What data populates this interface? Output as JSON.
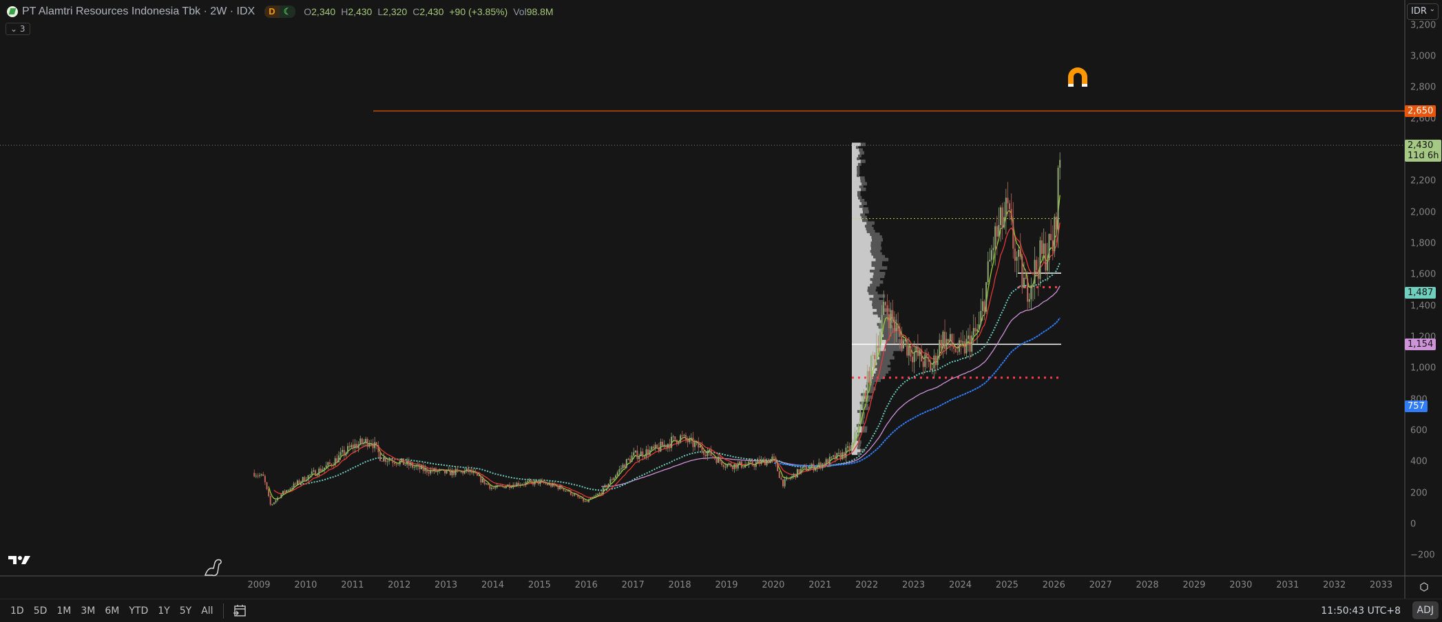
{
  "header": {
    "title": "PT Alamtri Resources Indonesia Tbk · 2W · IDX",
    "badge_d": "D",
    "badge_m": "☾",
    "open_k": "O",
    "open": "2,340",
    "high_k": "H",
    "high": "2,430",
    "low_k": "L",
    "low": "2,320",
    "close_k": "C",
    "close": "2,430",
    "change": "+90 (+3.85%)",
    "vol_k": "Vol",
    "vol": "98.8M",
    "indicators_collapsed": "⌄ 3"
  },
  "currency": {
    "label": "IDR",
    "chevron": "⌄"
  },
  "price_axis": {
    "ticks": [
      3200,
      3000,
      2800,
      2600,
      2400,
      2200,
      2000,
      1800,
      1600,
      1400,
      1200,
      1000,
      800,
      600,
      400,
      200,
      0,
      -200
    ],
    "tick_labels": [
      "3,200",
      "3,000",
      "2,800",
      "2,600",
      "",
      "2,200",
      "2,000",
      "1,800",
      "1,600",
      "1,400",
      "1,200",
      "1,000",
      "800",
      "600",
      "400",
      "200",
      "0",
      "−200"
    ],
    "labels": [
      {
        "value": 2650,
        "text": "2,650",
        "bg": "#e8560c",
        "fg": "#ffffff"
      },
      {
        "value": 2430,
        "text": "2,430",
        "sub": "11d 6h",
        "bg": "#a5c882",
        "fg": "#111111"
      },
      {
        "value": 1487,
        "text": "1,487",
        "bg": "#6fd0c0",
        "fg": "#111111"
      },
      {
        "value": 1154,
        "text": "1,154",
        "bg": "#ce93d8",
        "fg": "#111111"
      },
      {
        "value": 757,
        "text": "757",
        "bg": "#2f7cf6",
        "fg": "#ffffff"
      }
    ]
  },
  "time_axis": {
    "years": [
      "2009",
      "2010",
      "2011",
      "2012",
      "2013",
      "2014",
      "2015",
      "2016",
      "2017",
      "2018",
      "2019",
      "2020",
      "2021",
      "2022",
      "2023",
      "2024",
      "2025",
      "2026",
      "2027",
      "2028",
      "2029",
      "2030",
      "2031",
      "2032",
      "2033"
    ]
  },
  "chart_data": {
    "type": "candlestick",
    "interval": "2W",
    "price_path": [
      [
        2008.9,
        330
      ],
      [
        2009.1,
        300
      ],
      [
        2009.25,
        120
      ],
      [
        2009.5,
        200
      ],
      [
        2010,
        300
      ],
      [
        2010.5,
        380
      ],
      [
        2011,
        500
      ],
      [
        2011.4,
        540
      ],
      [
        2011.6,
        430
      ],
      [
        2012,
        400
      ],
      [
        2012.5,
        350
      ],
      [
        2013,
        330
      ],
      [
        2013.5,
        340
      ],
      [
        2014,
        230
      ],
      [
        2014.5,
        260
      ],
      [
        2015,
        270
      ],
      [
        2015.5,
        230
      ],
      [
        2016,
        140
      ],
      [
        2016.3,
        200
      ],
      [
        2016.8,
        380
      ],
      [
        2017,
        440
      ],
      [
        2017.5,
        480
      ],
      [
        2018,
        560
      ],
      [
        2018.5,
        480
      ],
      [
        2019,
        380
      ],
      [
        2019.5,
        380
      ],
      [
        2020,
        420
      ],
      [
        2020.2,
        260
      ],
      [
        2020.6,
        350
      ],
      [
        2021,
        380
      ],
      [
        2021.5,
        450
      ],
      [
        2021.7,
        500
      ],
      [
        2022,
        900
      ],
      [
        2022.4,
        1400
      ],
      [
        2022.7,
        1200
      ],
      [
        2023,
        1100
      ],
      [
        2023.4,
        1000
      ],
      [
        2023.6,
        1200
      ],
      [
        2024,
        1100
      ],
      [
        2024.4,
        1250
      ],
      [
        2024.7,
        1800
      ],
      [
        2025,
        2000
      ],
      [
        2025.2,
        1700
      ],
      [
        2025.4,
        1500
      ],
      [
        2025.7,
        1700
      ],
      [
        2026,
        1800
      ],
      [
        2026.15,
        2430
      ]
    ],
    "levels": {
      "resistance": 2650,
      "last": 2430,
      "poc_high": 1960,
      "range_high": 1610,
      "support_high": 1520,
      "poc_low": 1154,
      "support_low": 940
    },
    "colors": {
      "up": "#8fa876",
      "down": "#c0665a",
      "ma_fast": "#9acd32",
      "ma_mid": "#e53935",
      "ma_slow": "#6fd0c0",
      "ma_long": "#ce93d8",
      "ma_200": "#2f7cf6"
    }
  },
  "bottom_bar": {
    "ranges": [
      "1D",
      "5D",
      "1M",
      "3M",
      "6M",
      "YTD",
      "1Y",
      "5Y",
      "All"
    ],
    "clock": "11:50:43 UTC+8",
    "adj": "ADJ"
  }
}
